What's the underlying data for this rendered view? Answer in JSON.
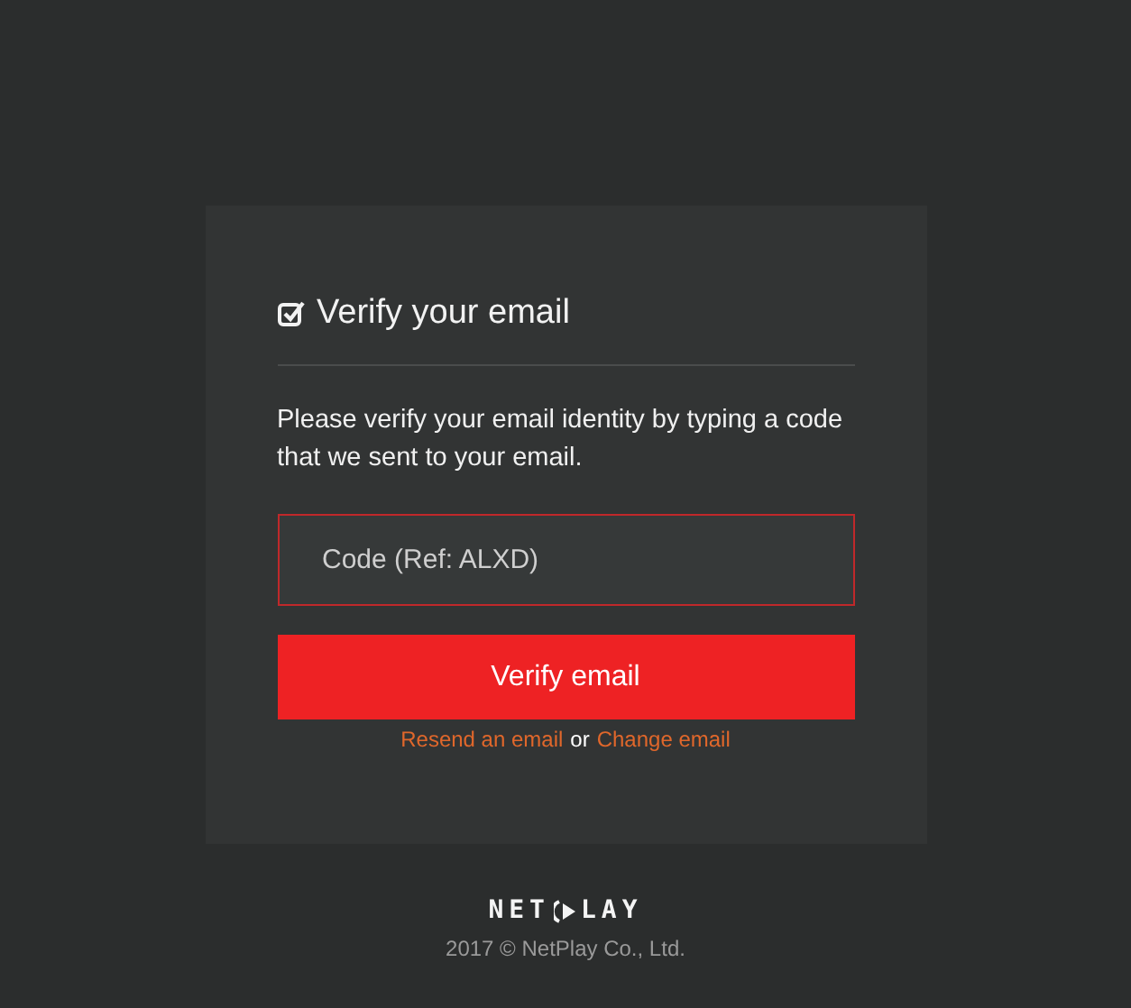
{
  "card": {
    "title": "Verify your email",
    "message": "Please verify your email identity by typing a code that we sent to your email.",
    "code_field": {
      "placeholder": "Code (Ref: ALXD)"
    },
    "submit_button": "Verify email",
    "links": [
      {
        "kind": "link",
        "text": "Resend an email"
      },
      {
        "kind": "text",
        "text": "or"
      },
      {
        "kind": "link",
        "text": "Change email"
      }
    ]
  },
  "footer": {
    "logo": {
      "left": "NET",
      "right": "LAY"
    },
    "copyright": "2017 © NetPlay Co., Ltd."
  }
}
